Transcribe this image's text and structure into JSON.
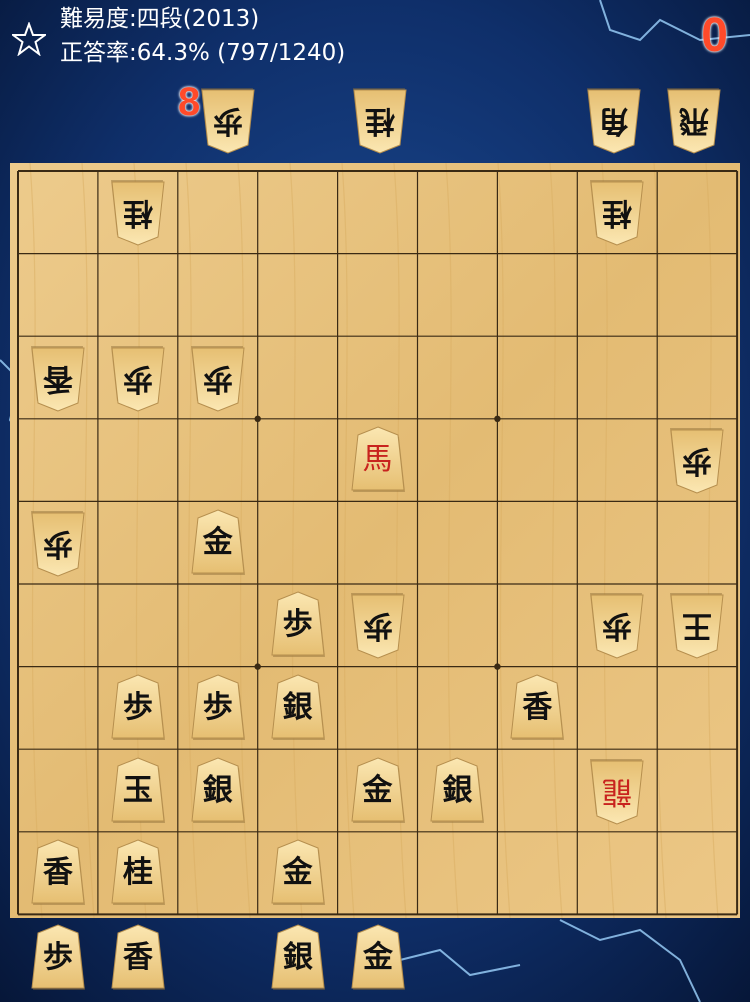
{
  "header": {
    "difficulty": "難易度:四段(2013)",
    "accuracy": "正答率:64.3% (797/1240)",
    "score": "0"
  },
  "hands": {
    "gote": {
      "count_label": "8",
      "pieces": [
        {
          "kanji": "歩"
        },
        {
          "kanji": "桂"
        },
        {
          "kanji": "角"
        },
        {
          "kanji": "飛"
        }
      ]
    },
    "sente": {
      "pieces": [
        {
          "kanji": "歩"
        },
        {
          "kanji": "香"
        },
        {
          "kanji": "銀"
        },
        {
          "kanji": "金"
        }
      ]
    }
  },
  "board": {
    "pieces": [
      {
        "col": 1,
        "row": 0,
        "kanji": "桂",
        "owner": "gote"
      },
      {
        "col": 7,
        "row": 0,
        "kanji": "桂",
        "owner": "gote"
      },
      {
        "col": 0,
        "row": 2,
        "kanji": "香",
        "owner": "gote"
      },
      {
        "col": 1,
        "row": 2,
        "kanji": "歩",
        "owner": "gote"
      },
      {
        "col": 2,
        "row": 2,
        "kanji": "歩",
        "owner": "gote"
      },
      {
        "col": 4,
        "row": 3,
        "kanji": "馬",
        "owner": "sente",
        "promoted": true
      },
      {
        "col": 8,
        "row": 3,
        "kanji": "歩",
        "owner": "gote"
      },
      {
        "col": 0,
        "row": 4,
        "kanji": "歩",
        "owner": "gote"
      },
      {
        "col": 2,
        "row": 4,
        "kanji": "金",
        "owner": "sente"
      },
      {
        "col": 3,
        "row": 5,
        "kanji": "歩",
        "owner": "sente"
      },
      {
        "col": 4,
        "row": 5,
        "kanji": "歩",
        "owner": "gote"
      },
      {
        "col": 7,
        "row": 5,
        "kanji": "歩",
        "owner": "gote"
      },
      {
        "col": 8,
        "row": 5,
        "kanji": "王",
        "owner": "gote"
      },
      {
        "col": 1,
        "row": 6,
        "kanji": "歩",
        "owner": "sente"
      },
      {
        "col": 2,
        "row": 6,
        "kanji": "歩",
        "owner": "sente"
      },
      {
        "col": 3,
        "row": 6,
        "kanji": "銀",
        "owner": "sente"
      },
      {
        "col": 6,
        "row": 6,
        "kanji": "香",
        "owner": "sente"
      },
      {
        "col": 1,
        "row": 7,
        "kanji": "玉",
        "owner": "sente"
      },
      {
        "col": 2,
        "row": 7,
        "kanji": "銀",
        "owner": "sente"
      },
      {
        "col": 4,
        "row": 7,
        "kanji": "金",
        "owner": "sente"
      },
      {
        "col": 5,
        "row": 7,
        "kanji": "銀",
        "owner": "sente"
      },
      {
        "col": 7,
        "row": 7,
        "kanji": "龍",
        "owner": "gote",
        "promoted": true
      },
      {
        "col": 0,
        "row": 8,
        "kanji": "香",
        "owner": "sente"
      },
      {
        "col": 1,
        "row": 8,
        "kanji": "桂",
        "owner": "sente"
      },
      {
        "col": 3,
        "row": 8,
        "kanji": "金",
        "owner": "sente"
      }
    ]
  },
  "colors": {
    "board_wood": "#e8c27e",
    "grid_line": "#3a2a14",
    "promoted_text": "#c8231e",
    "counter_text": "#ff4a2a"
  }
}
